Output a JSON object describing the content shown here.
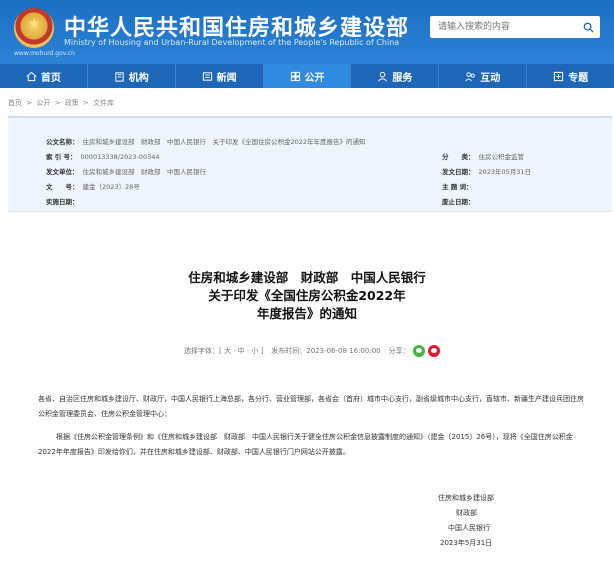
{
  "header": {
    "title_cn": "中华人民共和国住房和城乡建设部",
    "title_en": "Ministry of Housing and Urban-Rural Development of the People's Republic of China",
    "site_url": "www.mohurd.gov.cn",
    "search_placeholder": "请输入搜索的内容",
    "colors": {
      "primary": "#1e66b8",
      "active": "#2f8ae0"
    }
  },
  "nav": {
    "items": [
      {
        "label": "首页",
        "icon": "home-icon"
      },
      {
        "label": "机构",
        "icon": "building-icon"
      },
      {
        "label": "新闻",
        "icon": "news-icon"
      },
      {
        "label": "公开",
        "icon": "open-gov-icon"
      },
      {
        "label": "服务",
        "icon": "service-icon"
      },
      {
        "label": "互动",
        "icon": "interaction-icon"
      },
      {
        "label": "专题",
        "icon": "topic-icon"
      }
    ]
  },
  "breadcrumb": [
    "首页",
    ">",
    "公开",
    ">",
    "政策",
    ">",
    "文件库"
  ],
  "info": {
    "index_label": "公文名称：",
    "index_value": "住房和城乡建设部　财政部　中国人民银行　关于印发《全国住房公积金2022年年度报告》的通知",
    "id_label": "索 引 号：",
    "id_value": "000013338/2023-00344",
    "category_label": "分　　类：",
    "category_value": "住房公积金监管",
    "issuer_label": "发文单位：",
    "issuer_value": "住房和城乡建设部　财政部　中国人民银行",
    "date_label": "发文日期：",
    "date_value": "2023年05月31日",
    "number_label": "文　　号：",
    "number_value": "建金〔2023〕28号",
    "keywords_label": "主 题 词：",
    "keywords_value": "",
    "effective_label": "实施日期：",
    "effective_value": "",
    "expiry_label": "废止日期：",
    "expiry_value": ""
  },
  "article": {
    "title_line1": "住房和城乡建设部　财政部　中国人民银行",
    "title_line2": "关于印发《全国住房公积金2022年",
    "title_line3": "年度报告》的通知",
    "font_size_label": "选择字体：[ 大 · 中 · 小 ]",
    "publish_label": "发布时间：2023-06-08 16:00:00",
    "share_label": "分享：",
    "para1": "各省、自治区住房和城乡建设厅、财政厅，中国人民银行上海总部，各分行、营业管理部，各省会（首府）城市中心支行，副省级城市中心支行，直辖市、新疆生产建设兵团住房公积金管理委员会、住房公积金管理中心：",
    "para2": "根据《住房公积金管理条例》和《住房和城乡建设部　财政部　中国人民银行关于健全住房公积金信息披露制度的通知》（建金〔2015〕26号），现将《全国住房公积金2022年年度报告》印发给你们，并在住房和城乡建设部、财政部、中国人民银行门户网站公开披露。",
    "sign1": "住房和城乡建设部",
    "sign2": "财政部",
    "sign3": "中国人民银行",
    "sign4": "2023年5月31日"
  }
}
